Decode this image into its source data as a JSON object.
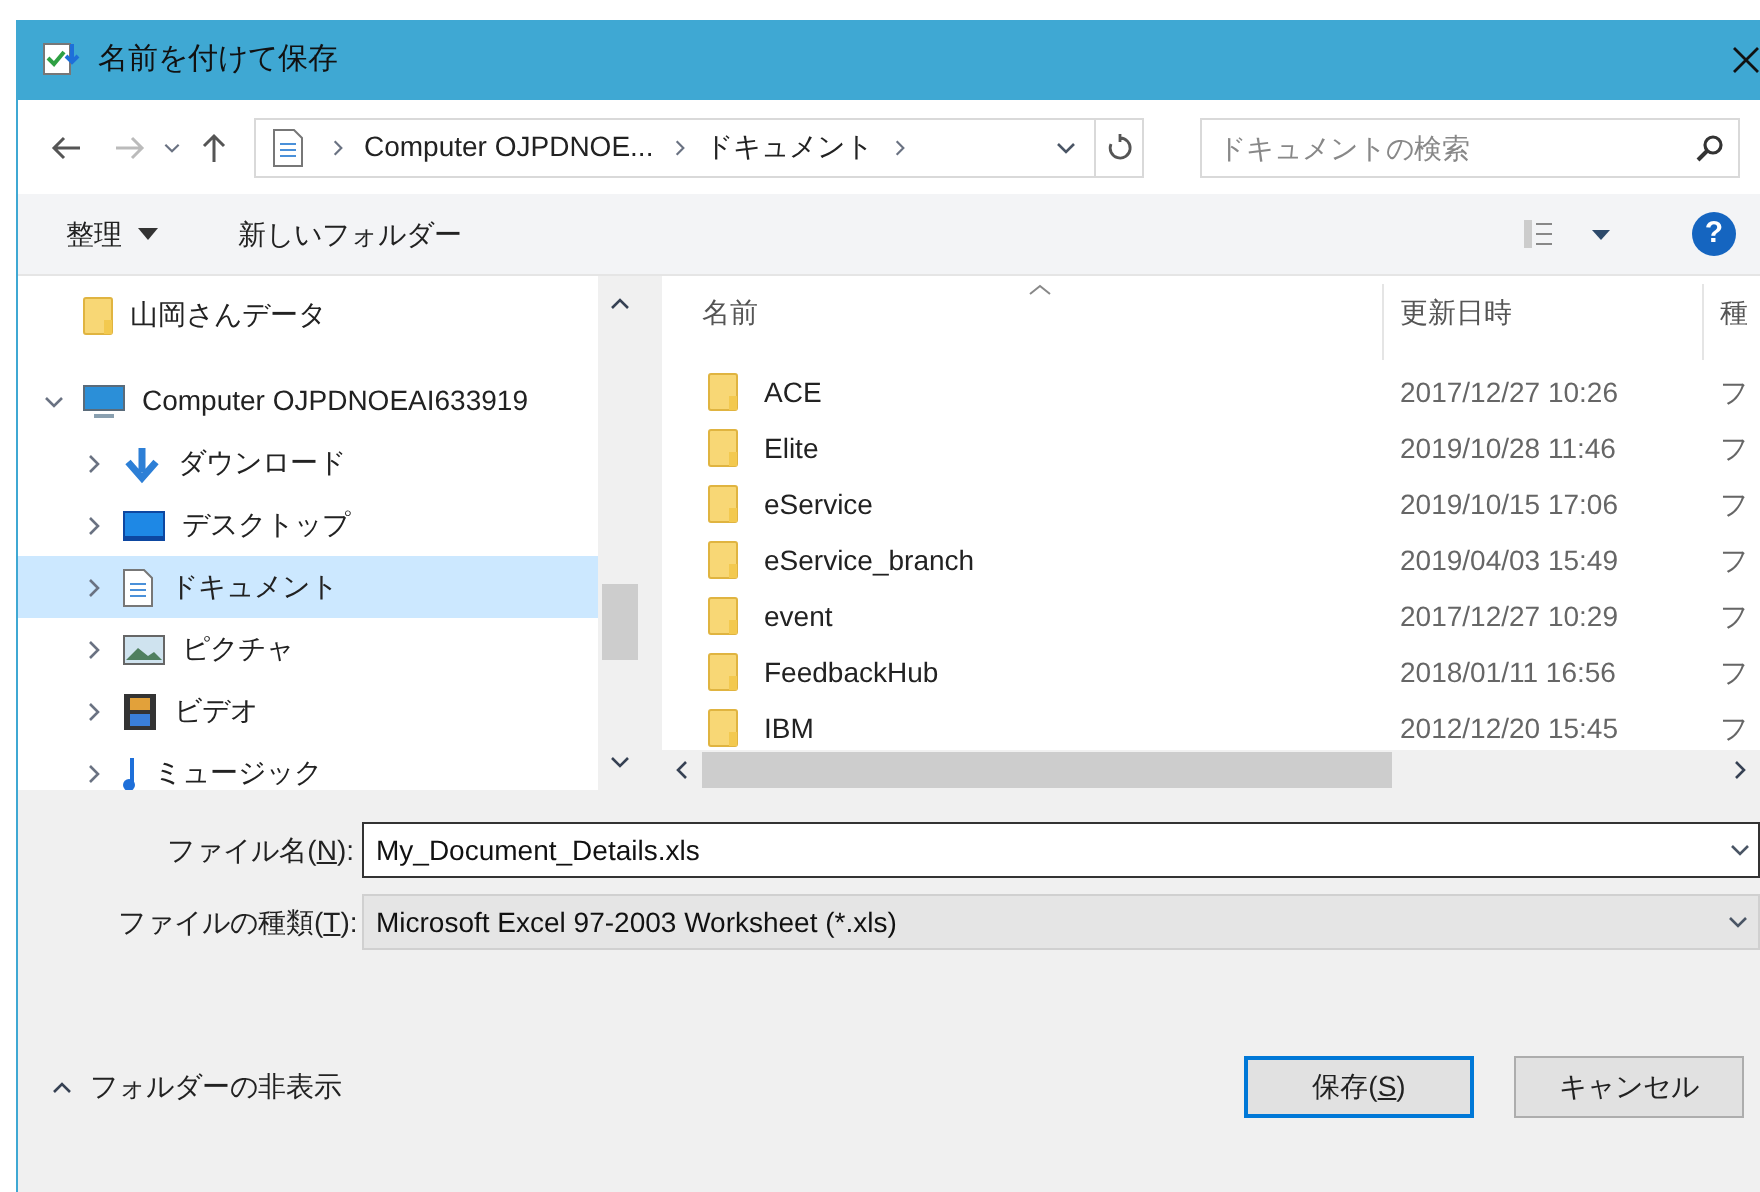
{
  "window": {
    "title": "名前を付けて保存"
  },
  "address": {
    "crumbs": [
      "Computer OJPDNOE...",
      "ドキュメント"
    ]
  },
  "search": {
    "placeholder": "ドキュメントの検索"
  },
  "toolbar": {
    "organize": "整理",
    "new_folder": "新しいフォルダー",
    "help": "?"
  },
  "nav": [
    {
      "label": "山岡さんデータ",
      "kind": "folder",
      "selected": false,
      "has_toggle": false
    },
    {
      "label": "Computer OJPDNOEAI633919",
      "kind": "computer",
      "expanded": true,
      "selected": false,
      "has_toggle": true,
      "children": [
        {
          "label": "ダウンロード",
          "kind": "download",
          "expanded": false,
          "selected": false,
          "has_toggle": true
        },
        {
          "label": "デスクトップ",
          "kind": "desktop",
          "expanded": false,
          "selected": false,
          "has_toggle": true
        },
        {
          "label": "ドキュメント",
          "kind": "document",
          "expanded": false,
          "selected": true,
          "has_toggle": true
        },
        {
          "label": "ピクチャ",
          "kind": "picture",
          "expanded": false,
          "selected": false,
          "has_toggle": true
        },
        {
          "label": "ビデオ",
          "kind": "video",
          "expanded": false,
          "selected": false,
          "has_toggle": true
        },
        {
          "label": "ミュージック",
          "kind": "music",
          "expanded": false,
          "selected": false,
          "has_toggle": true
        }
      ]
    }
  ],
  "table": {
    "columns": [
      "名前",
      "更新日時",
      "種"
    ],
    "rows": [
      {
        "name": "ACE",
        "modified": "2017/12/27 10:26",
        "column_3": "フ"
      },
      {
        "name": "Elite",
        "modified": "2019/10/28 11:46",
        "column_3": "フ"
      },
      {
        "name": "eService",
        "modified": "2019/10/15 17:06",
        "column_3": "フ"
      },
      {
        "name": "eService_branch",
        "modified": "2019/04/03 15:49",
        "column_3": "フ"
      },
      {
        "name": "event",
        "modified": "2017/12/27 10:29",
        "column_3": "フ"
      },
      {
        "name": "FeedbackHub",
        "modified": "2018/01/11 16:56",
        "column_3": "フ"
      },
      {
        "name": "IBM",
        "modified": "2012/12/20 15:45",
        "column_3": "フ"
      }
    ]
  },
  "fields": [
    {
      "kind": "input",
      "label_before": "ファイル名(",
      "mnemonic": "N",
      "label_after": "):",
      "value": "My_Document_Details.xls"
    },
    {
      "kind": "select",
      "label_before": "ファイルの種類(",
      "mnemonic": "T",
      "label_after": "):",
      "value": "Microsoft Excel 97-2003 Worksheet (*.xls)"
    }
  ],
  "hide_folders": "フォルダーの非表示",
  "buttons": [
    {
      "label_before": "保存(",
      "mnemonic": "S",
      "label_after": ")",
      "default": true
    },
    {
      "label": "キャンセル",
      "default": false
    }
  ]
}
